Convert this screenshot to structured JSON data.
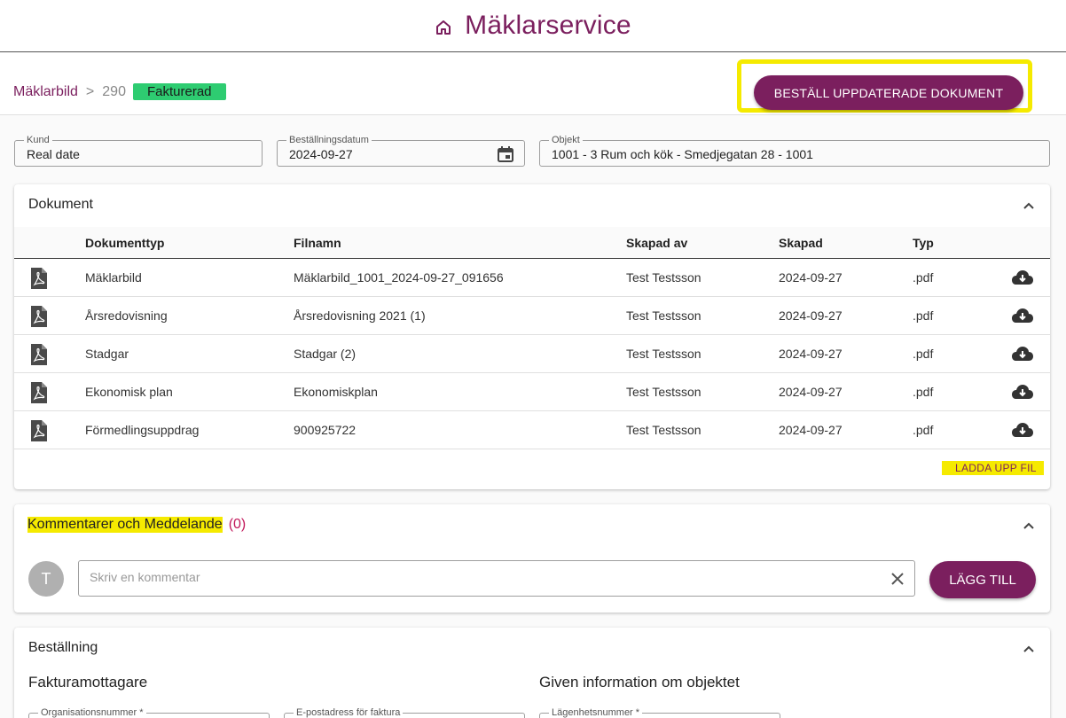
{
  "header": {
    "title": "Mäklarservice",
    "icon": "home-icon"
  },
  "breadcrumb": {
    "root": "Mäklarbild",
    "separator": ">",
    "id": "290",
    "status": "Fakturerad"
  },
  "order_button": {
    "label": "BESTÄLL UPPDATERADE DOKUMENT"
  },
  "fields": {
    "kund": {
      "label": "Kund",
      "value": "Real date"
    },
    "datum": {
      "label": "Beställningsdatum",
      "value": "2024-09-27"
    },
    "objekt": {
      "label": "Objekt",
      "value": "1001 - 3 Rum och kök - Smedjegatan 28 - 1001"
    }
  },
  "documents": {
    "title": "Dokument",
    "columns": [
      "Dokumenttyp",
      "Filnamn",
      "Skapad av",
      "Skapad",
      "Typ"
    ],
    "rows": [
      {
        "type": "Mäklarbild",
        "file": "Mäklarbild_1001_2024-09-27_091656",
        "by": "Test Testsson",
        "date": "2024-09-27",
        "ext": ".pdf"
      },
      {
        "type": "Årsredovisning",
        "file": "Årsredovisning 2021 (1)",
        "by": "Test Testsson",
        "date": "2024-09-27",
        "ext": ".pdf"
      },
      {
        "type": "Stadgar",
        "file": "Stadgar (2)",
        "by": "Test Testsson",
        "date": "2024-09-27",
        "ext": ".pdf"
      },
      {
        "type": "Ekonomisk plan",
        "file": "Ekonomiskplan",
        "by": "Test Testsson",
        "date": "2024-09-27",
        "ext": ".pdf"
      },
      {
        "type": "Förmedlingsuppdrag",
        "file": "900925722",
        "by": "Test Testsson",
        "date": "2024-09-27",
        "ext": ".pdf"
      }
    ],
    "upload_label": "LADDA UPP FIL"
  },
  "comments": {
    "title": "Kommentarer och Meddelande",
    "count": "(0)",
    "avatar_initial": "T",
    "placeholder": "Skriv en kommentar",
    "add_label": "LÄGG TILL"
  },
  "order": {
    "title": "Beställning",
    "left_heading": "Fakturamottagare",
    "right_heading": "Given information om objektet",
    "field1": "Organisationsnummer *",
    "field2": "E-postadress för faktura",
    "field3": "Lägenhetsnummer *"
  },
  "colors": {
    "brand": "#7b1f5e",
    "status_green": "#2ecc71",
    "highlight": "#f5ea00"
  }
}
